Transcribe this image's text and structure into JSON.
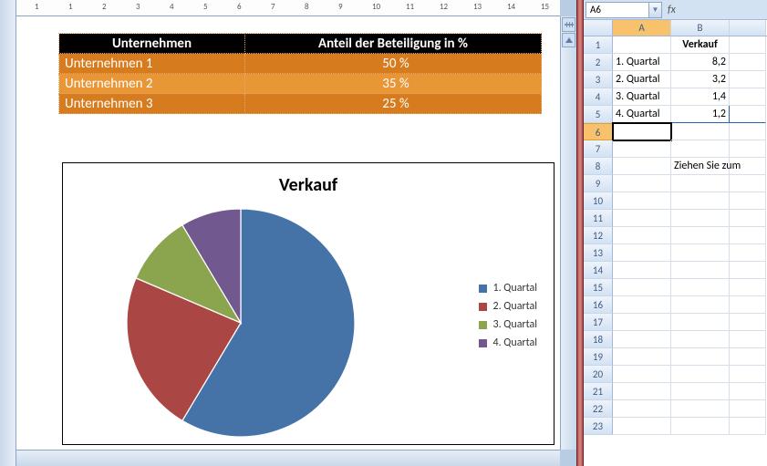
{
  "word": {
    "ruler_tab": "L",
    "ruler_numbers": [
      "1",
      "1",
      "2",
      "3",
      "4",
      "5",
      "6",
      "7",
      "8",
      "9",
      "10",
      "11",
      "12",
      "13",
      "14",
      "15"
    ]
  },
  "company_table": {
    "headers": [
      "Unternehmen",
      "Anteil der Beteiligung in %"
    ],
    "rows": [
      {
        "name": "Unternehmen 1",
        "pct": "50 %"
      },
      {
        "name": "Unternehmen 2",
        "pct": "35 %"
      },
      {
        "name": "Unternehmen 3",
        "pct": "25 %"
      }
    ]
  },
  "chart_data": {
    "type": "pie",
    "title": "Verkauf",
    "series": [
      {
        "name": "1. Quartal",
        "value": 8.2,
        "color": "#4573a7"
      },
      {
        "name": "2. Quartal",
        "value": 3.2,
        "color": "#aa4644"
      },
      {
        "name": "3. Quartal",
        "value": 1.4,
        "color": "#8aa54e"
      },
      {
        "name": "4. Quartal",
        "value": 1.2,
        "color": "#71588f"
      }
    ]
  },
  "excel": {
    "namebox": "A6",
    "fx": "fx",
    "columns": [
      "A",
      "B"
    ],
    "header_b1": "Verkauf",
    "data_rows": [
      {
        "a": "1. Quartal",
        "b": "8,2"
      },
      {
        "a": "2. Quartal",
        "b": "3,2"
      },
      {
        "a": "3. Quartal",
        "b": "1,4"
      },
      {
        "a": "4. Quartal",
        "b": "1,2"
      }
    ],
    "note_b8": "Ziehen Sie zum",
    "active_cell_row": 6,
    "active_col": "A",
    "row_count": 23
  }
}
